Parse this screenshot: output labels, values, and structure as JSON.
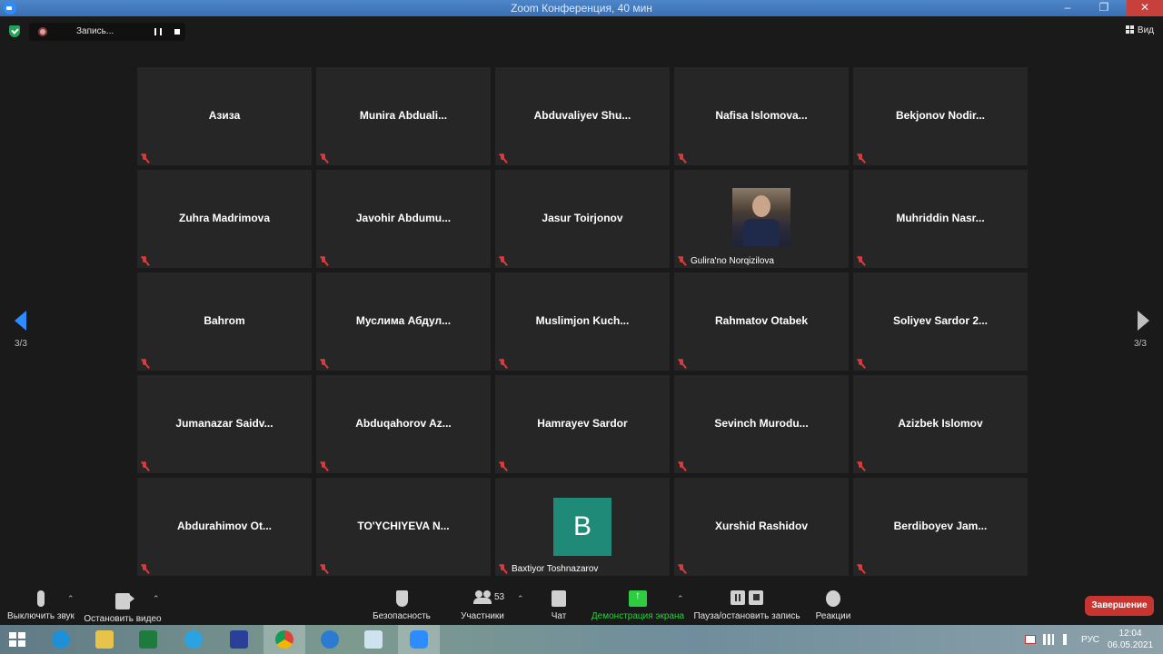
{
  "window": {
    "title": "Zoom Конференция, 40 мин",
    "minimize": "–",
    "maximize": "❐",
    "close": "✕"
  },
  "recording": {
    "label": "Запись..."
  },
  "view_button": {
    "label": "Вид"
  },
  "participants_tiles": [
    {
      "name": "Азиза"
    },
    {
      "name": "Munira  Abduali..."
    },
    {
      "name": "Abduvaliyev  Shu..."
    },
    {
      "name": "Nafisa  Islomova..."
    },
    {
      "name": "Bekjonov  Nodir..."
    },
    {
      "name": "Zuhra Madrimova"
    },
    {
      "name": "Javohir  Abdumu..."
    },
    {
      "name": "Jasur Toirjonov"
    },
    {
      "name": "Gulira'no Norqizilova",
      "has_video": true
    },
    {
      "name": "Muhriddin  Nasr..."
    },
    {
      "name": "Bahrom"
    },
    {
      "name": "Муслима  Абдул..."
    },
    {
      "name": "Muslimjon  Kuch..."
    },
    {
      "name": "Rahmatov Otabek"
    },
    {
      "name": "Soliyev Sardor 2..."
    },
    {
      "name": "Jumanazar  Saidv..."
    },
    {
      "name": "Abduqahorov  Az..."
    },
    {
      "name": "Hamrayev Sardor"
    },
    {
      "name": "Sevinch  Murodu..."
    },
    {
      "name": "Azizbek Islomov"
    },
    {
      "name": "Abdurahimov  Ot..."
    },
    {
      "name": "TO'YCHIYEVA  N..."
    },
    {
      "name": "Baxtiyor Toshnazarov",
      "avatar_letter": "B",
      "avatar_color": "#1f8a78"
    },
    {
      "name": "Xurshid Rashidov"
    },
    {
      "name": "Berdiboyev  Jam..."
    }
  ],
  "pagination": {
    "left": "3/3",
    "right": "3/3"
  },
  "toolbar": {
    "mute": "Выключить звук",
    "video": "Остановить видео",
    "security": "Безопасность",
    "participants": "Участники",
    "participants_count": "53",
    "chat": "Чат",
    "share": "Демонстрация экрана",
    "record": "Пауза/остановить запись",
    "reactions": "Реакции",
    "end": "Завершение"
  },
  "colors": {
    "accent_blue": "#2d8cff",
    "share_green": "#2ecc40",
    "end_red": "#c8342f",
    "tile_bg": "#262626"
  },
  "taskbar": {
    "lang": "РУС",
    "time": "12:04",
    "date": "06.05.2021"
  }
}
